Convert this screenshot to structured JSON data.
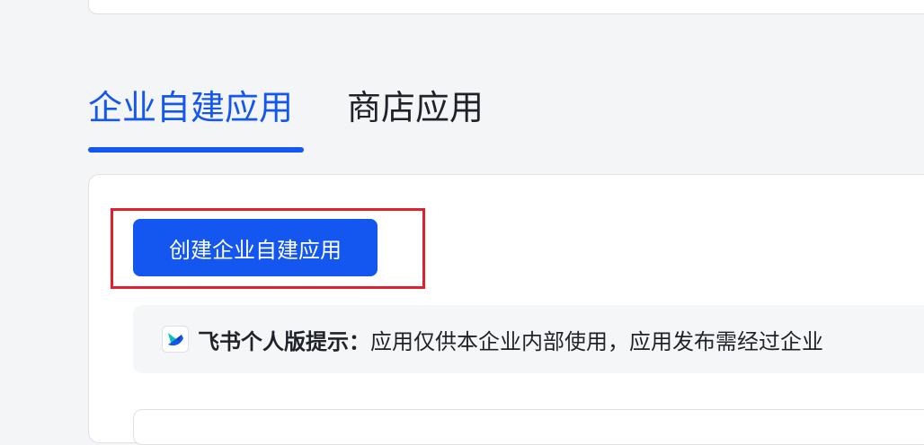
{
  "tabs": {
    "items": [
      {
        "label": "企业自建应用",
        "active": true
      },
      {
        "label": "商店应用",
        "active": false
      }
    ]
  },
  "create_button": {
    "label": "创建企业自建应用"
  },
  "notice": {
    "icon": "feishu-logo-icon",
    "title": "飞书个人版提示：",
    "body": "应用仅供本企业内部使用，应用发布需经过企业"
  },
  "colors": {
    "accent": "#1456f0",
    "highlight": "#e0202a",
    "page_background": "#f4f5f7"
  }
}
